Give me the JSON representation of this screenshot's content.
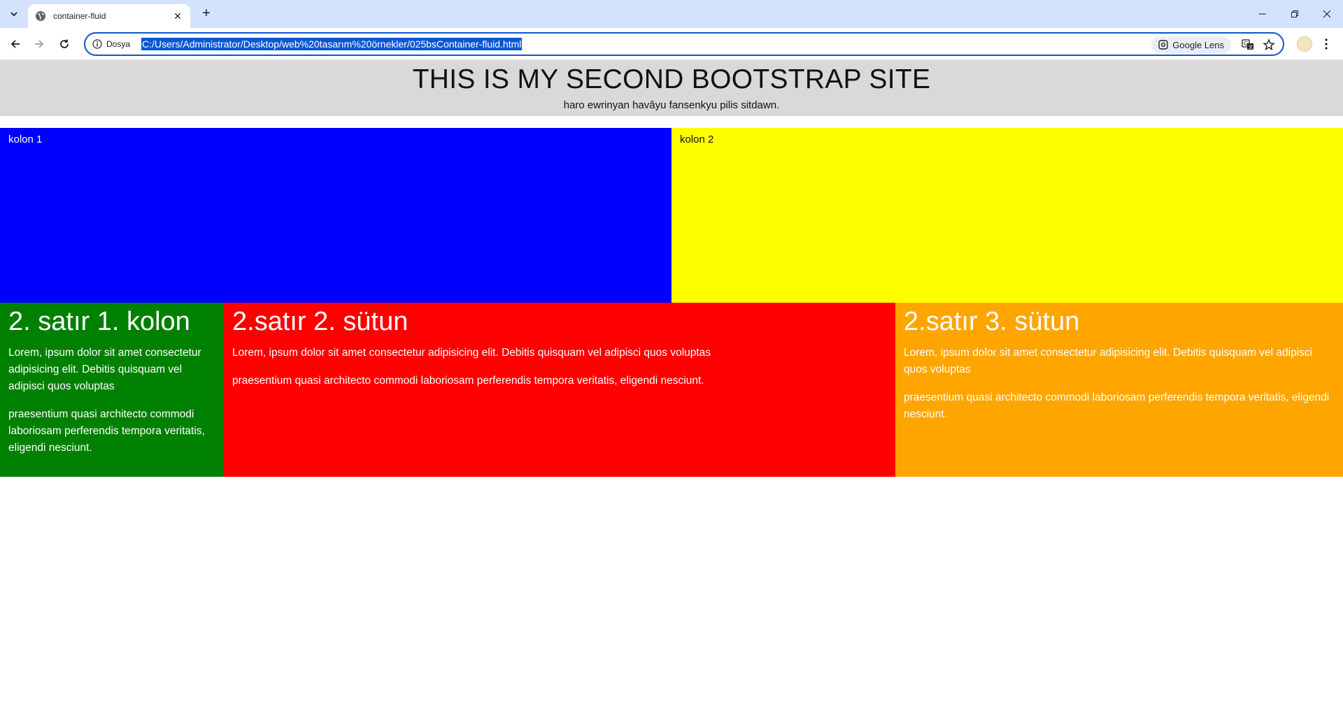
{
  "browser": {
    "tab_title": "container-fluid",
    "site_info_label": "Dosya",
    "url": "C:/Users/Administrator/Desktop/web%20tasarım%20örnekler/025bsContainer-fluid.html",
    "lens_label": "Google Lens"
  },
  "header": {
    "title": "THIS IS MY SECOND BOOTSTRAP SITE",
    "subtitle": "haro ewrinyan havâyu fansenkyu pilis sitdawn."
  },
  "row1": {
    "col1": "kolon 1",
    "col2": "kolon 2"
  },
  "row2": {
    "col1": {
      "heading": "2. satır 1. kolon",
      "p1": "Lorem, ipsum dolor sit amet consectetur adipisicing elit. Debitis quisquam vel adipisci quos voluptas",
      "p2": "praesentium quasi architecto commodi laboriosam perferendis tempora veritatis, eligendi nesciunt."
    },
    "col2": {
      "heading": "2.satır 2. sütun",
      "p1": "Lorem, ipsum dolor sit amet consectetur adipisicing elit. Debitis quisquam vel adipisci quos voluptas",
      "p2": "praesentium quasi architecto commodi laboriosam perferendis tempora veritatis, eligendi nesciunt."
    },
    "col3": {
      "heading": "2.satır 3. sütun",
      "p1": "Lorem, ipsum dolor sit amet consectetur adipisicing elit. Debitis quisquam vel adipisci quos voluptas",
      "p2": "praesentium quasi architecto commodi laboriosam perferendis tempora veritatis, eligendi nesciunt."
    }
  },
  "colors": {
    "blue": "#0000ff",
    "yellow": "#ffff00",
    "green": "#008000",
    "red": "#ff0000",
    "orange": "#ffa500",
    "jumbotron": "#d9d9d9"
  }
}
